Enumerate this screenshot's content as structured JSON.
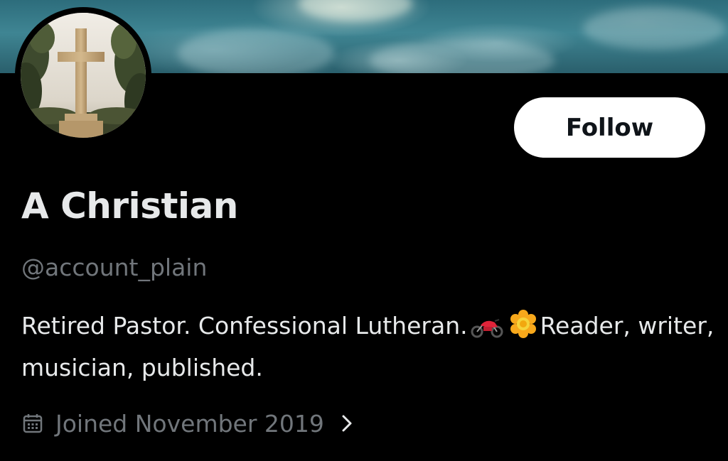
{
  "profile": {
    "display_name": "A Christian",
    "handle": "@account_plain",
    "bio_part1": "Retired Pastor. Confessional Lutheran.",
    "bio_part2": "Reader, writer, musician, published.",
    "bio_emojis": [
      "motorcycle-icon",
      "flower-icon"
    ],
    "joined": "Joined November 2019"
  },
  "actions": {
    "follow_label": "Follow"
  },
  "icons": {
    "joined_icon": "calendar-icon",
    "joined_chevron": "chevron-right-icon"
  },
  "colors": {
    "background": "#000000",
    "primary_text": "#e7e9ea",
    "secondary_text": "#71767b",
    "follow_button_bg": "#ffffff",
    "follow_button_text": "#0f1419"
  }
}
